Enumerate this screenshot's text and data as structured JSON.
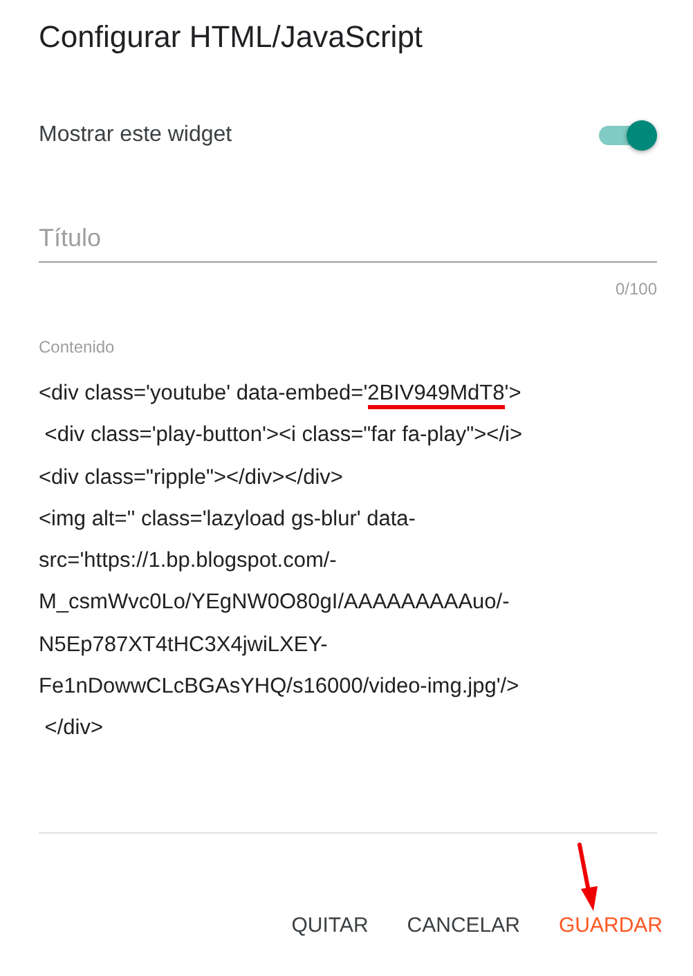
{
  "dialog": {
    "title": "Configurar HTML/JavaScript"
  },
  "show_widget": {
    "label": "Mostrar este widget",
    "on": true
  },
  "title_field": {
    "placeholder": "Título",
    "counter": "0/100"
  },
  "content": {
    "label": "Contenido",
    "lines": [
      {
        "parts": [
          {
            "text": "<div class='youtube' data-embed='",
            "underlined": false
          },
          {
            "text": "2BIV949MdT8",
            "underlined": true
          },
          {
            "text": "'>",
            "underlined": false
          }
        ]
      },
      {
        "parts": [
          {
            "text": " <div class='play-button'><i class=\"far fa-play\"></i>",
            "underlined": false
          }
        ]
      },
      {
        "parts": [
          {
            "text": "<div class=\"ripple\"></div></div>",
            "underlined": false
          }
        ]
      },
      {
        "parts": [
          {
            "text": "<img alt='' class='lazyload gs-blur' data-",
            "underlined": false
          }
        ]
      },
      {
        "parts": [
          {
            "text": "src='https://1.bp.blogspot.com/-",
            "underlined": false
          }
        ]
      },
      {
        "parts": [
          {
            "text": "M_csmWvc0Lo/YEgNW0O80gI/AAAAAAAAAuo/-",
            "underlined": false
          }
        ]
      },
      {
        "parts": [
          {
            "text": "N5Ep787XT4tHC3X4jwiLXEY-",
            "underlined": false
          }
        ]
      },
      {
        "parts": [
          {
            "text": "Fe1nDowwCLcBGAsYHQ/s16000/video-img.jpg'/>",
            "underlined": false
          }
        ]
      },
      {
        "parts": [
          {
            "text": " </div>",
            "underlined": false
          }
        ]
      }
    ]
  },
  "buttons": [
    {
      "label": "QUITAR",
      "kind": "plain"
    },
    {
      "label": "CANCELAR",
      "kind": "plain"
    },
    {
      "label": "GUARDAR",
      "kind": "primary"
    }
  ]
}
